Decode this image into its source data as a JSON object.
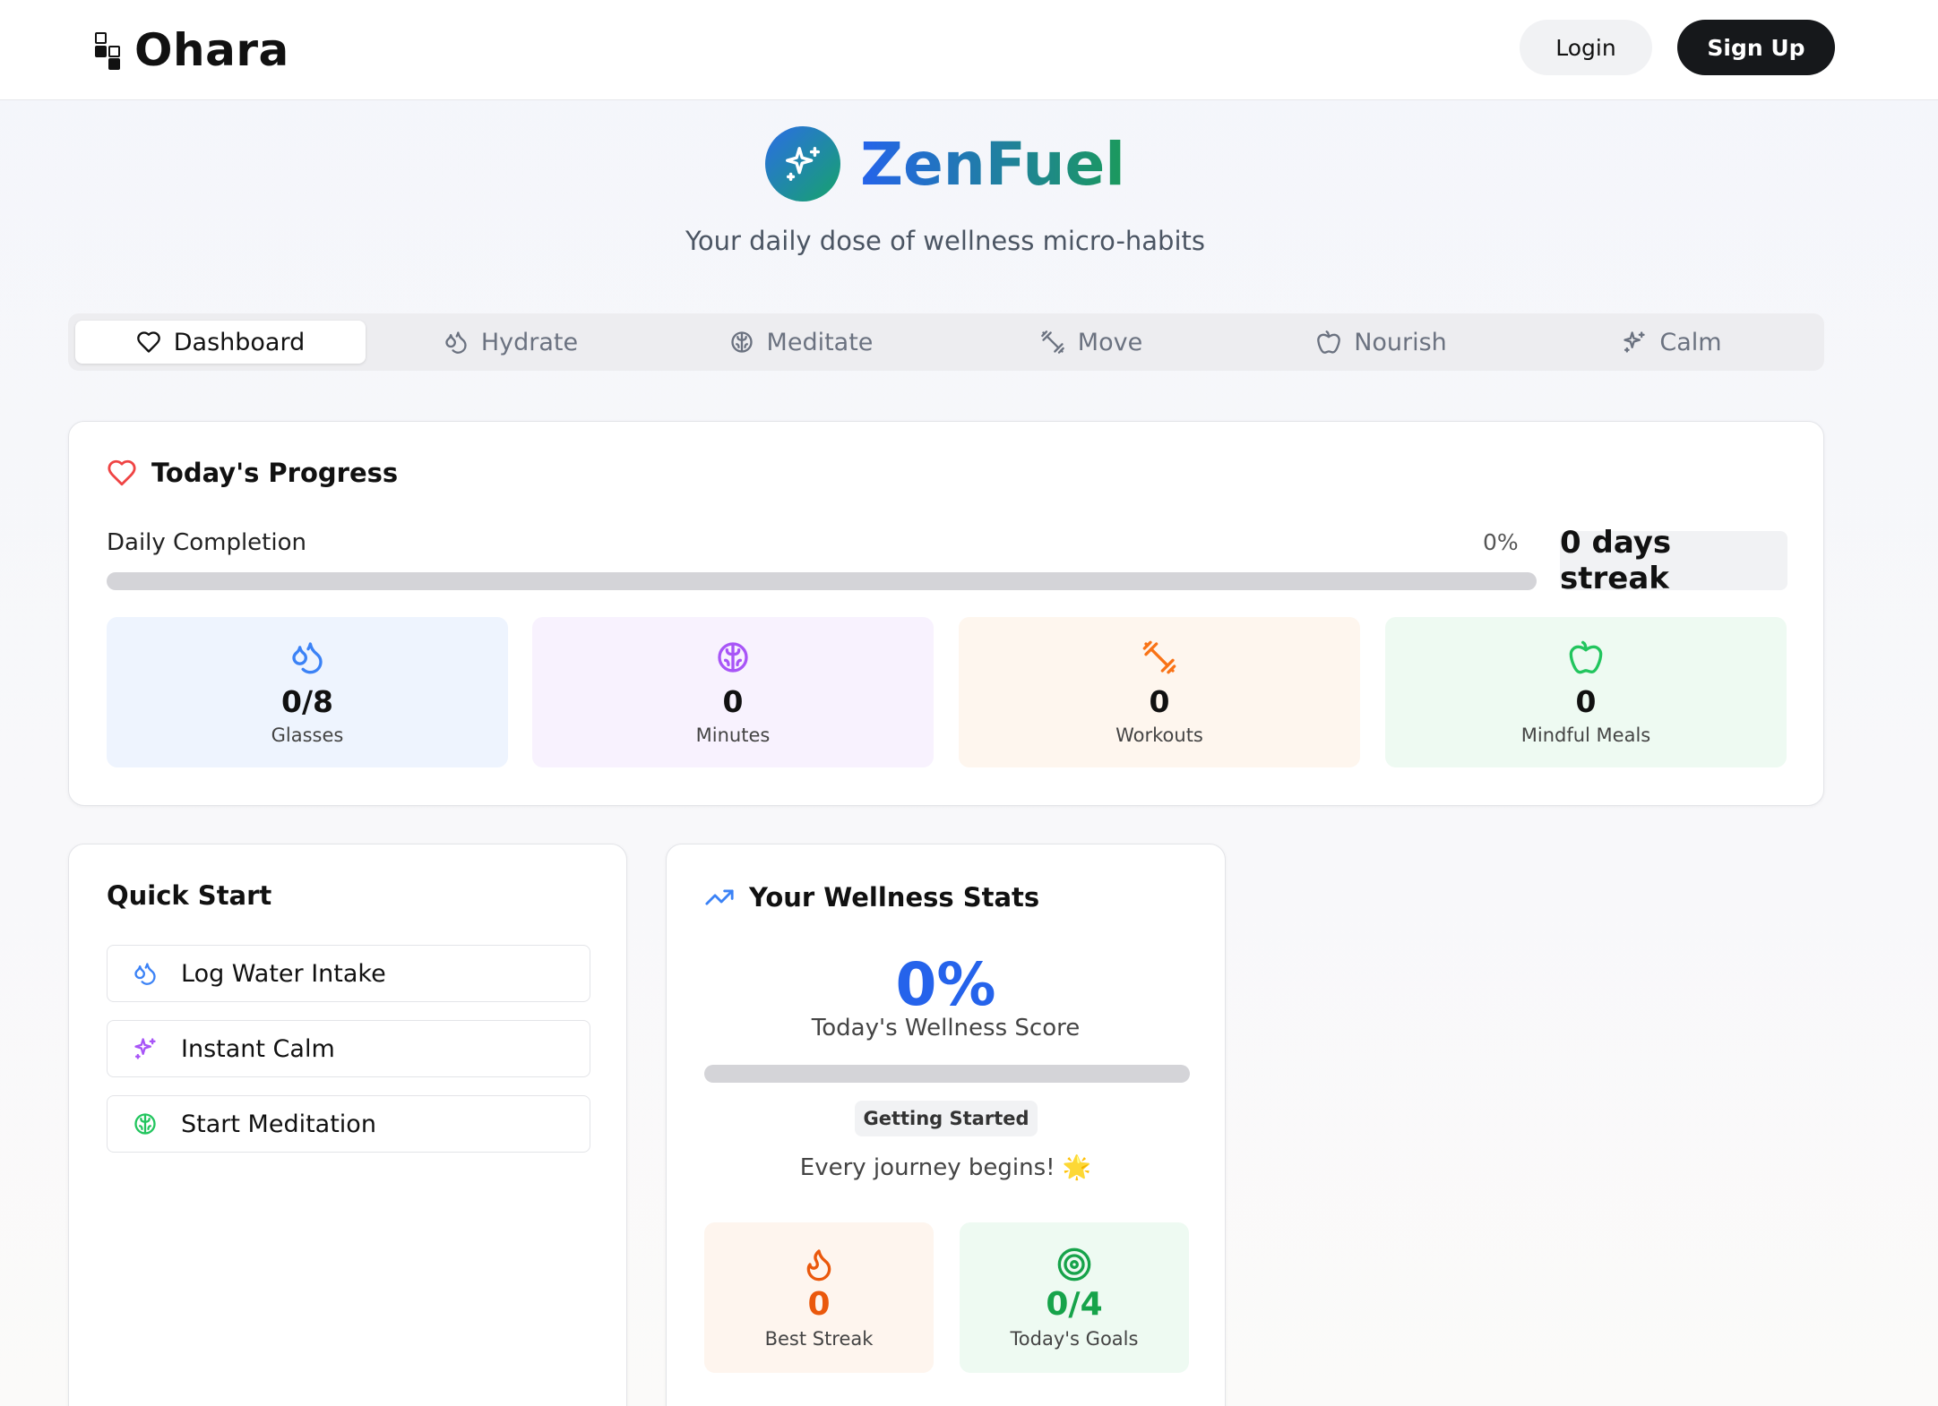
{
  "header": {
    "brand": "Ohara",
    "login": "Login",
    "signup": "Sign Up"
  },
  "hero": {
    "title": "ZenFuel",
    "subtitle": "Your daily dose of wellness micro-habits"
  },
  "tabs": [
    {
      "label": "Dashboard",
      "icon": "heart-icon",
      "active": true
    },
    {
      "label": "Hydrate",
      "icon": "droplets-icon"
    },
    {
      "label": "Meditate",
      "icon": "brain-icon"
    },
    {
      "label": "Move",
      "icon": "dumbbell-icon"
    },
    {
      "label": "Nourish",
      "icon": "apple-icon"
    },
    {
      "label": "Calm",
      "icon": "sparkles-icon"
    }
  ],
  "progress": {
    "title": "Today's Progress",
    "completion_label": "Daily Completion",
    "completion_pct": "0%",
    "completion_value": 0,
    "streak": "0 days streak",
    "stats": [
      {
        "value": "0/8",
        "label": "Glasses",
        "icon": "droplets-icon",
        "color": "#3b82f6",
        "bg": "#eef4fe"
      },
      {
        "value": "0",
        "label": "Minutes",
        "icon": "brain-icon",
        "color": "#a855f7",
        "bg": "#f8f2fe"
      },
      {
        "value": "0",
        "label": "Workouts",
        "icon": "dumbbell-icon",
        "color": "#f97316",
        "bg": "#fef6ee"
      },
      {
        "value": "0",
        "label": "Mindful Meals",
        "icon": "apple-icon",
        "color": "#22c55e",
        "bg": "#eefaf2"
      }
    ]
  },
  "quick_start": {
    "title": "Quick Start",
    "items": [
      {
        "label": "Log Water Intake",
        "icon": "droplets-icon",
        "color": "#3b82f6"
      },
      {
        "label": "Instant Calm",
        "icon": "sparkles-icon",
        "color": "#a855f7"
      },
      {
        "label": "Start Meditation",
        "icon": "brain-icon",
        "color": "#22c55e"
      }
    ]
  },
  "wellness": {
    "title": "Your Wellness Stats",
    "score": "0%",
    "score_value": 0,
    "score_label": "Today's Wellness Score",
    "level": "Getting Started",
    "message": "Every journey begins! 🌟",
    "tiles": [
      {
        "value": "0",
        "label": "Best Streak",
        "icon": "flame-icon",
        "color": "#ea580c",
        "bg": "#fef5ee"
      },
      {
        "value": "0/4",
        "label": "Today's Goals",
        "icon": "target-icon",
        "color": "#16a34a",
        "bg": "#eefaf2"
      }
    ]
  },
  "colors": {
    "accent_blue": "#2563eb",
    "accent_green": "#16a34a",
    "dark_button": "#16181b"
  }
}
